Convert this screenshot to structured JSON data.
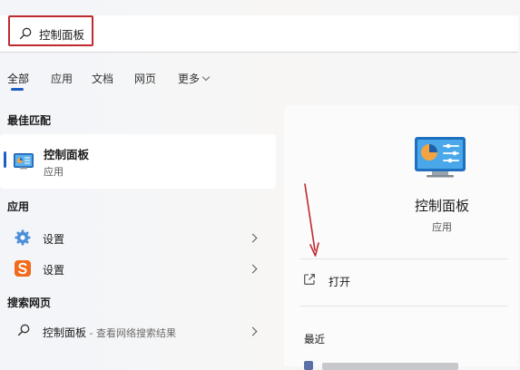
{
  "search": {
    "query": "控制面板"
  },
  "tabs": [
    {
      "label": "全部",
      "active": true
    },
    {
      "label": "应用"
    },
    {
      "label": "文档"
    },
    {
      "label": "网页"
    },
    {
      "label": "更多"
    }
  ],
  "best_match": {
    "heading": "最佳匹配",
    "title": "控制面板",
    "subtitle": "应用",
    "icon": "control-panel-icon"
  },
  "apps": {
    "heading": "应用",
    "items": [
      {
        "label": "设置",
        "icon": "gear-icon"
      },
      {
        "label": "设置",
        "icon": "sogou-s-icon"
      }
    ]
  },
  "web_search": {
    "heading": "搜索网页",
    "query": "控制面板",
    "suffix": " - 查看网络搜索结果",
    "icon": "search-icon"
  },
  "detail": {
    "app_name": "控制面板",
    "app_type": "应用",
    "open_label": "打开",
    "recent_label": "最近"
  },
  "colors": {
    "accent": "#1b5fc5",
    "highlight_box": "#c0292e",
    "annotation_arrow": "#c0292e"
  }
}
